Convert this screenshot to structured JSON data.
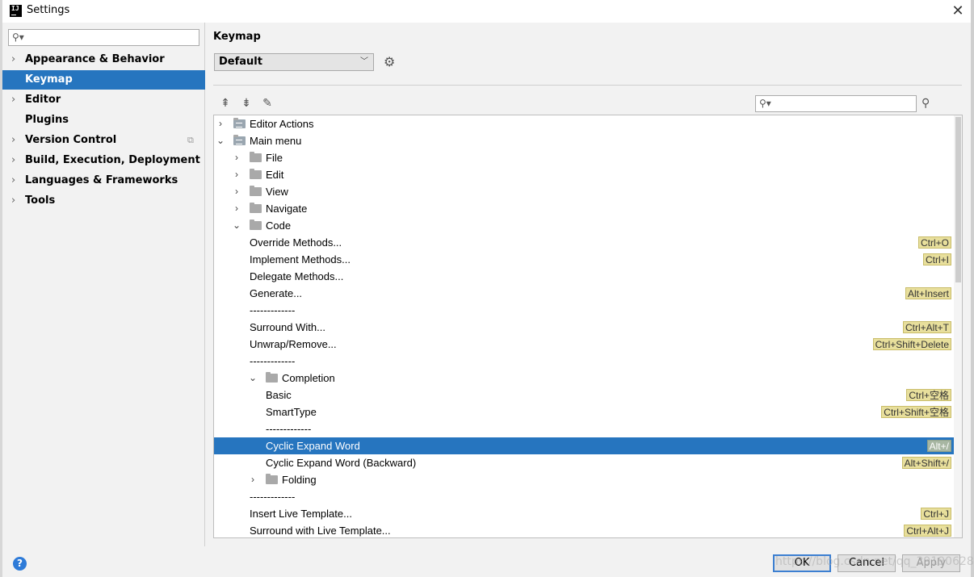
{
  "window": {
    "title": "Settings",
    "app_icon_text": "IJ"
  },
  "sidebar": {
    "search_placeholder": "",
    "items": [
      {
        "label": "Appearance & Behavior",
        "expandable": true
      },
      {
        "label": "Keymap",
        "selected": true
      },
      {
        "label": "Editor",
        "expandable": true
      },
      {
        "label": "Plugins"
      },
      {
        "label": "Version Control",
        "expandable": true
      },
      {
        "label": "Build, Execution, Deployment",
        "expandable": true
      },
      {
        "label": "Languages & Frameworks",
        "expandable": true
      },
      {
        "label": "Tools",
        "expandable": true
      }
    ]
  },
  "main": {
    "title": "Keymap",
    "keymap_value": "Default",
    "find_value": ""
  },
  "tree": [
    {
      "label": "Editor Actions",
      "level": 0,
      "arrow": "collapsed",
      "icon": "special"
    },
    {
      "label": "Main menu",
      "level": 0,
      "arrow": "expanded",
      "icon": "special"
    },
    {
      "label": "File",
      "level": 1,
      "arrow": "collapsed",
      "icon": "folder"
    },
    {
      "label": "Edit",
      "level": 1,
      "arrow": "collapsed",
      "icon": "folder"
    },
    {
      "label": "View",
      "level": 1,
      "arrow": "collapsed",
      "icon": "folder"
    },
    {
      "label": "Navigate",
      "level": 1,
      "arrow": "collapsed",
      "icon": "folder"
    },
    {
      "label": "Code",
      "level": 1,
      "arrow": "expanded",
      "icon": "folder"
    },
    {
      "label": "Override Methods...",
      "level": 2,
      "shortcut": "Ctrl+O"
    },
    {
      "label": "Implement Methods...",
      "level": 2,
      "shortcut": "Ctrl+I"
    },
    {
      "label": "Delegate Methods...",
      "level": 2
    },
    {
      "label": "Generate...",
      "level": 2,
      "shortcut": "Alt+Insert"
    },
    {
      "label": "-------------",
      "level": 2
    },
    {
      "label": "Surround With...",
      "level": 2,
      "shortcut": "Ctrl+Alt+T"
    },
    {
      "label": "Unwrap/Remove...",
      "level": 2,
      "shortcut": "Ctrl+Shift+Delete"
    },
    {
      "label": "-------------",
      "level": 2
    },
    {
      "label": "Completion",
      "level": 2,
      "arrow": "expanded",
      "icon": "folder"
    },
    {
      "label": "Basic",
      "level": 3,
      "shortcut": "Ctrl+空格"
    },
    {
      "label": "SmartType",
      "level": 3,
      "shortcut": "Ctrl+Shift+空格"
    },
    {
      "label": "-------------",
      "level": 3
    },
    {
      "label": "Cyclic Expand Word",
      "level": 3,
      "shortcut": "Alt+/",
      "selected": true
    },
    {
      "label": "Cyclic Expand Word (Backward)",
      "level": 3,
      "shortcut": "Alt+Shift+/"
    },
    {
      "label": "Folding",
      "level": 2,
      "arrow": "collapsed",
      "icon": "folder"
    },
    {
      "label": "-------------",
      "level": 2
    },
    {
      "label": "Insert Live Template...",
      "level": 2,
      "shortcut": "Ctrl+J"
    },
    {
      "label": "Surround with Live Template...",
      "level": 2,
      "shortcut": "Ctrl+Alt+J"
    }
  ],
  "footer": {
    "help_label": "?",
    "ok_label": "OK",
    "cancel_label": "Cancel",
    "apply_label": "Apply",
    "watermark": "https://blog.csdn.net/qq_39190628"
  }
}
